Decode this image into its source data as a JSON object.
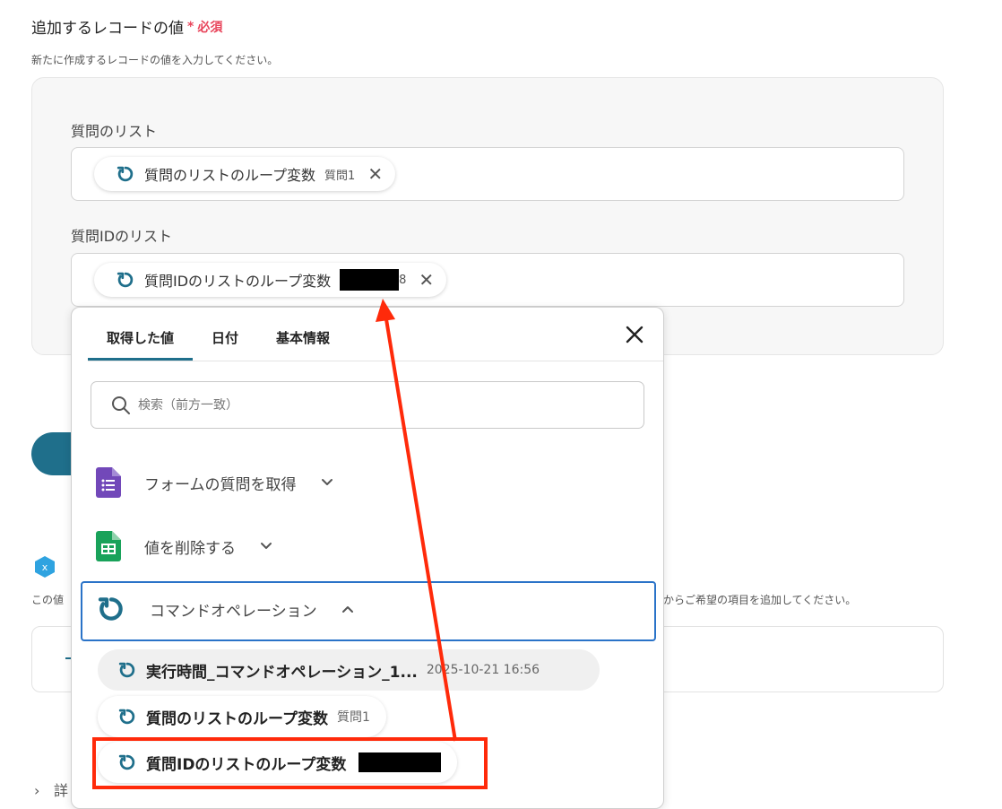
{
  "section": {
    "title": "追加するレコードの値",
    "required_mark": "*",
    "required_label": "必須",
    "description": "新たに作成するレコードの値を入力してください。"
  },
  "fields": [
    {
      "label": "質問のリスト",
      "chip_label": "質問のリストのループ変数",
      "chip_value": "質問1"
    },
    {
      "label": "質問IDのリスト",
      "chip_label": "質問IDのリストのループ変数",
      "chip_value_suffix": "8"
    }
  ],
  "background": {
    "text_left": "この値",
    "text_right": "からご希望の項目を追加してください。",
    "bottom_text": "詳"
  },
  "popup": {
    "tabs": [
      "取得した値",
      "日付",
      "基本情報"
    ],
    "active_tab": 0,
    "search_placeholder": "検索（前方一致）",
    "groups": [
      {
        "label": "フォームの質問を取得",
        "icon": "google-forms-icon",
        "expanded": false
      },
      {
        "label": "値を削除する",
        "icon": "google-sheets-icon",
        "expanded": false
      },
      {
        "label": "コマンドオペレーション",
        "icon": "loop-icon",
        "expanded": true
      }
    ],
    "items": [
      {
        "label": "実行時間_コマンドオペレーション_1...",
        "value": "2025-10-21 16:56"
      },
      {
        "label": "質問のリストのループ変数",
        "value": "質問1"
      },
      {
        "label": "質問IDのリストのループ変数",
        "value": ""
      }
    ]
  },
  "colors": {
    "accent": "#1f6f8b",
    "required": "#e8445a",
    "highlight": "#ff2a0a",
    "selection_border": "#2a73c8"
  }
}
